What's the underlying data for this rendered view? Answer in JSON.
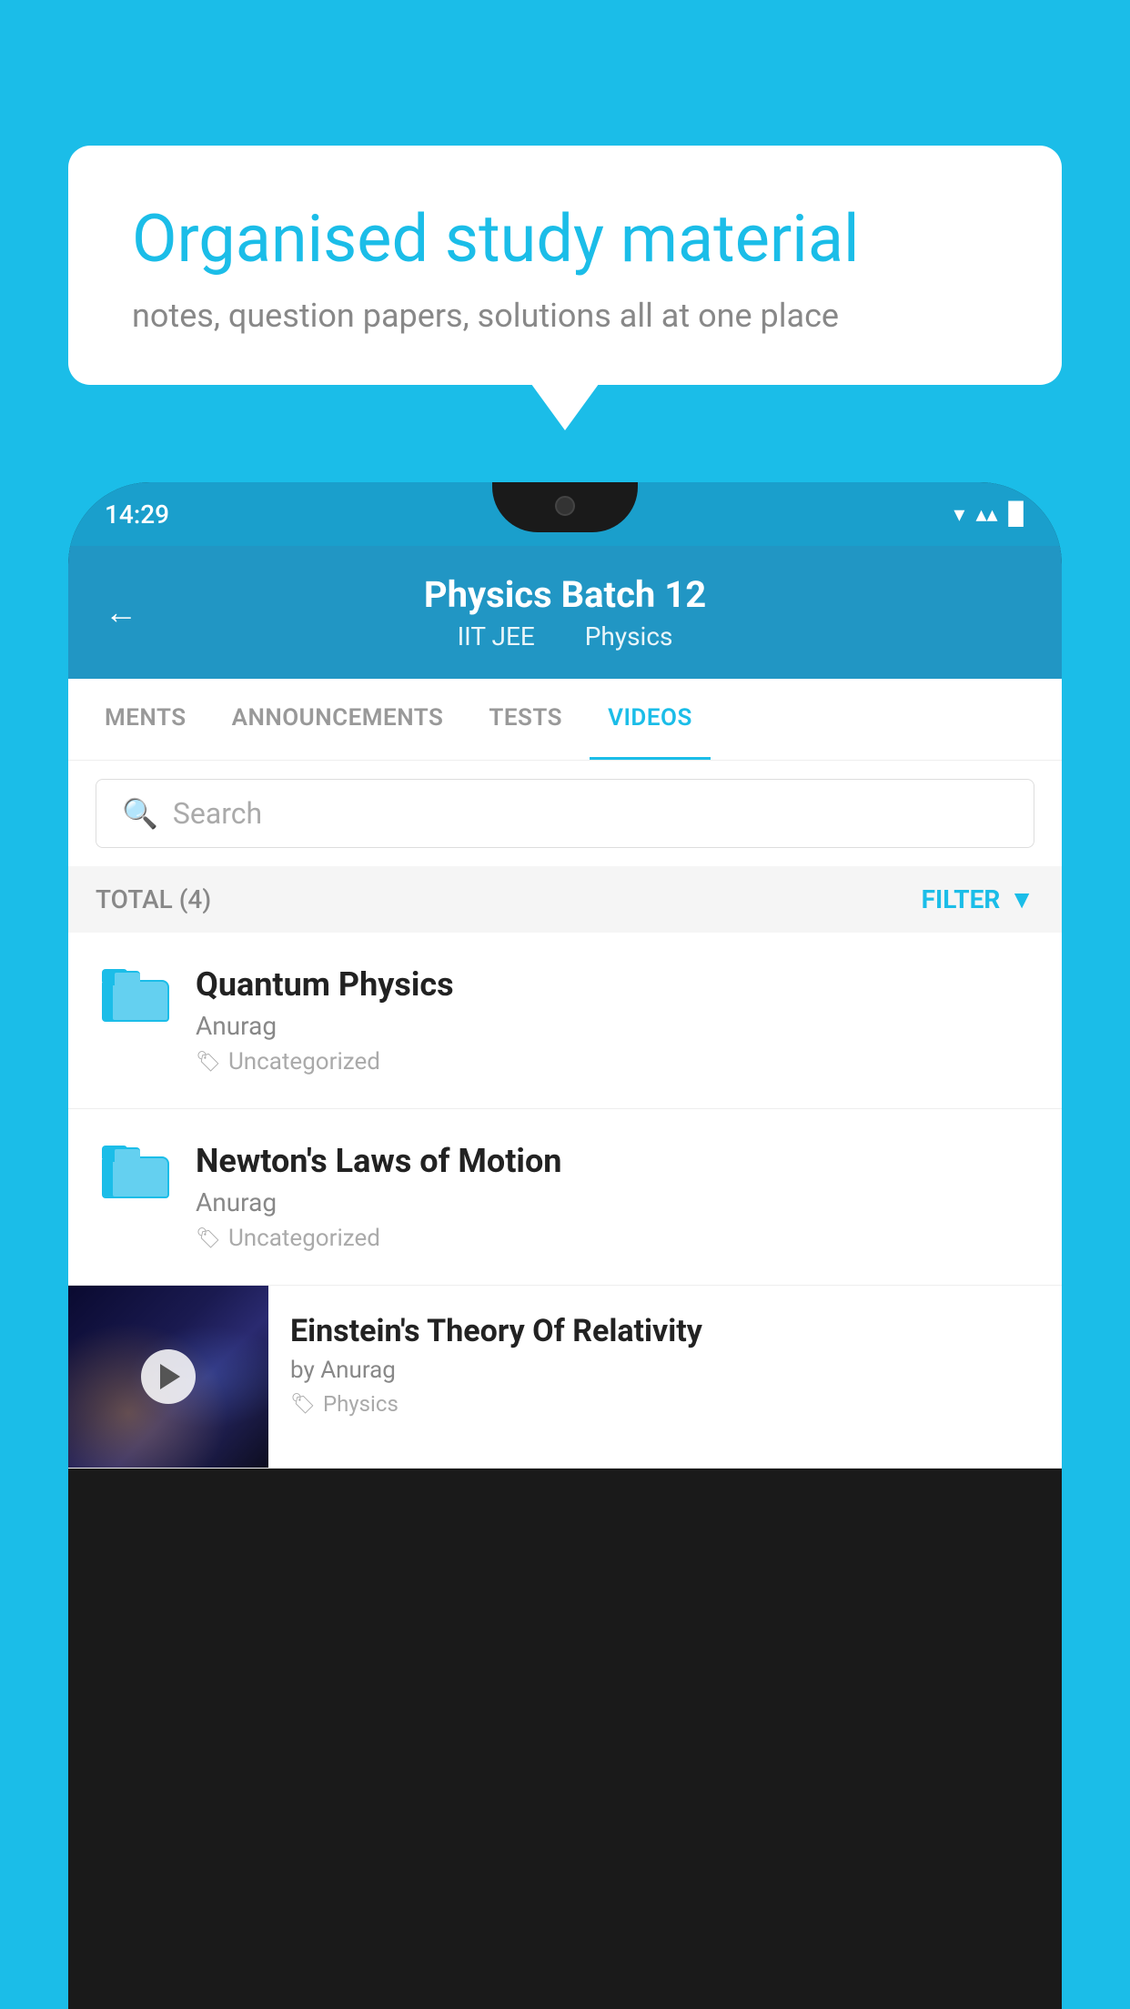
{
  "background": {
    "color": "#1BBDE8"
  },
  "hero": {
    "title": "Organised study material",
    "subtitle": "notes, question papers, solutions all at one place"
  },
  "phone": {
    "statusBar": {
      "time": "14:29"
    },
    "header": {
      "back": "←",
      "title": "Physics Batch 12",
      "subtitle1": "IIT JEE",
      "subtitle2": "Physics"
    },
    "tabs": [
      {
        "label": "MENTS",
        "active": false
      },
      {
        "label": "ANNOUNCEMENTS",
        "active": false
      },
      {
        "label": "TESTS",
        "active": false
      },
      {
        "label": "VIDEOS",
        "active": true
      }
    ],
    "search": {
      "placeholder": "Search"
    },
    "filter": {
      "total_label": "TOTAL (4)",
      "filter_label": "FILTER"
    },
    "videos": [
      {
        "type": "folder",
        "title": "Quantum Physics",
        "author": "Anurag",
        "tag": "Uncategorized"
      },
      {
        "type": "folder",
        "title": "Newton's Laws of Motion",
        "author": "Anurag",
        "tag": "Uncategorized"
      },
      {
        "type": "video",
        "title": "Einstein's Theory Of Relativity",
        "author": "by Anurag",
        "tag": "Physics"
      }
    ]
  }
}
